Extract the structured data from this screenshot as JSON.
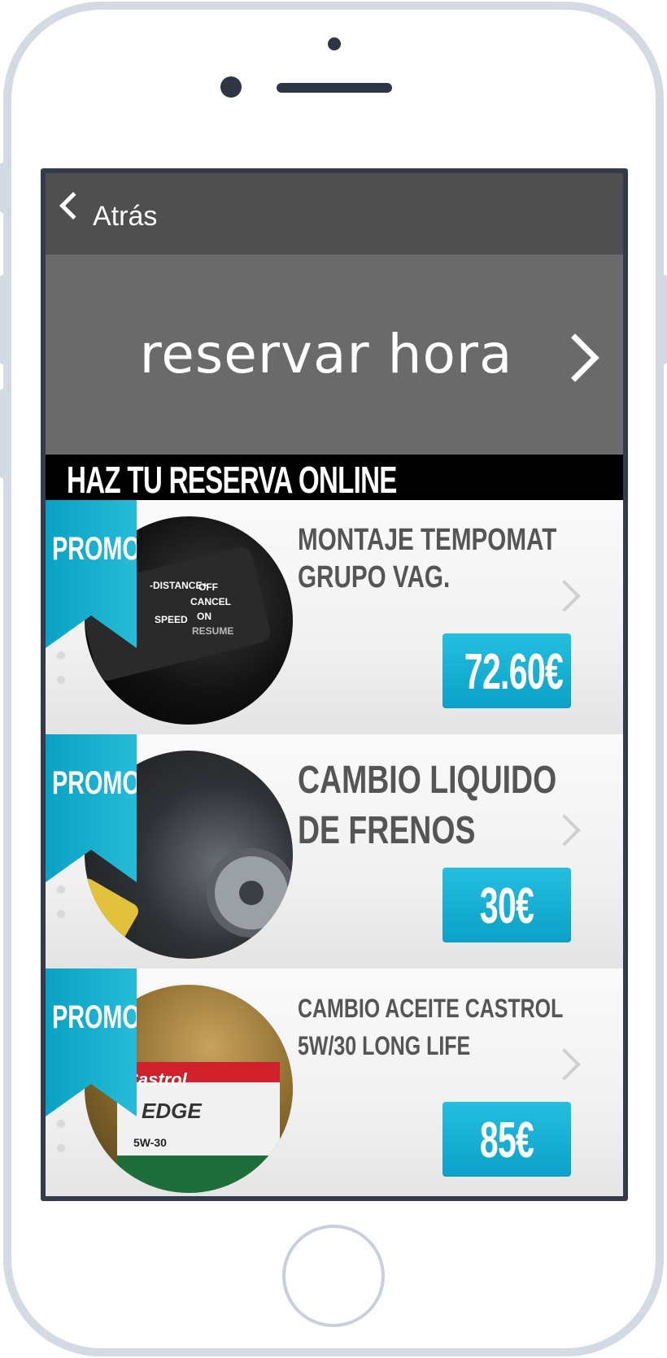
{
  "nav": {
    "back_label": "Atrás"
  },
  "banner": {
    "text": "reservar hora"
  },
  "section": {
    "title": "HAZ TU RESERVA ONLINE"
  },
  "items": [
    {
      "ribbon": "PROMO",
      "title_lines": [
        "MONTAJE TEMPOMAT",
        "GRUPO VAG."
      ],
      "price": "72.60€",
      "image_text": {
        "distance": "-DISTANCE+",
        "speed": "SPEED",
        "off": "OFF",
        "cancel": "CANCEL",
        "on": "ON",
        "resume": "RESUME"
      }
    },
    {
      "ribbon": "PROMO",
      "title_lines": [
        "CAMBIO LIQUIDO",
        "DE FRENOS"
      ],
      "price": "30€"
    },
    {
      "ribbon": "PROMO",
      "title_lines": [
        "CAMBIO ACEITE CASTROL",
        "5W/30 LONG LIFE"
      ],
      "price": "85€",
      "image_text": {
        "brand": "Castrol",
        "product": "EDGE",
        "spec": "5W-30"
      }
    }
  ],
  "colors": {
    "accent": "#17b1d4",
    "navbar": "#4f4f4f",
    "banner": "#6a6a6a",
    "header": "#000000",
    "frame": "#343b4a"
  },
  "icons": {
    "back": "chevron-left-icon",
    "banner": "chevron-right-icon",
    "item": "chevron-right-icon"
  }
}
